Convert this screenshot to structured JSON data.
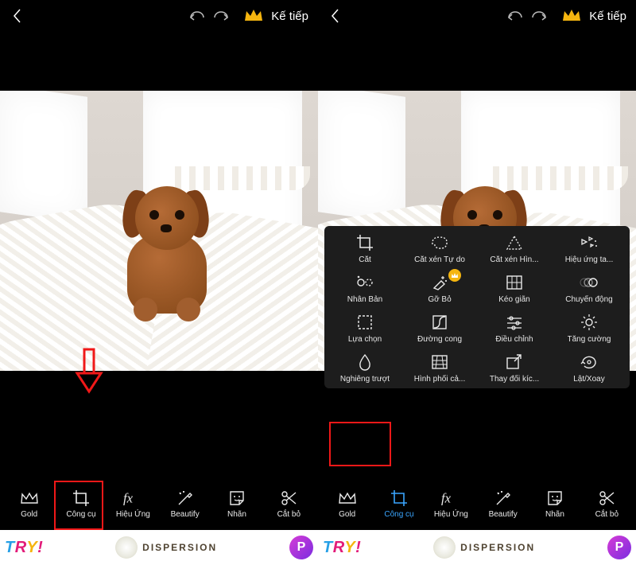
{
  "header": {
    "next_label": "Kế tiếp"
  },
  "tabs": {
    "gold": "Gold",
    "tools": "Công cụ",
    "effects": "Hiệu Ứng",
    "beautify": "Beautify",
    "sticker": "Nhãn",
    "cutout": "Cắt bỏ"
  },
  "tools_panel": {
    "crop": "Cắt",
    "free_crop": "Cắt xén Tự do",
    "shape_crop": "Cắt xén Hìn...",
    "dispersion": "Hiệu ứng ta...",
    "clone": "Nhân Bản",
    "remove": "Gỡ Bỏ",
    "stretch": "Kéo giãn",
    "motion": "Chuyển động",
    "selection": "Lựa chọn",
    "curves": "Đường cong",
    "adjust": "Điều chỉnh",
    "enhance": "Tăng cường",
    "tilt_shift": "Nghiêng trượt",
    "perspective": "Hình phối cả...",
    "resize": "Thay đổi kíc...",
    "flip_rotate": "Lật/Xoay"
  },
  "ad": {
    "try": "TRY!",
    "dispersion": "DISPERSION",
    "brand": "P"
  }
}
